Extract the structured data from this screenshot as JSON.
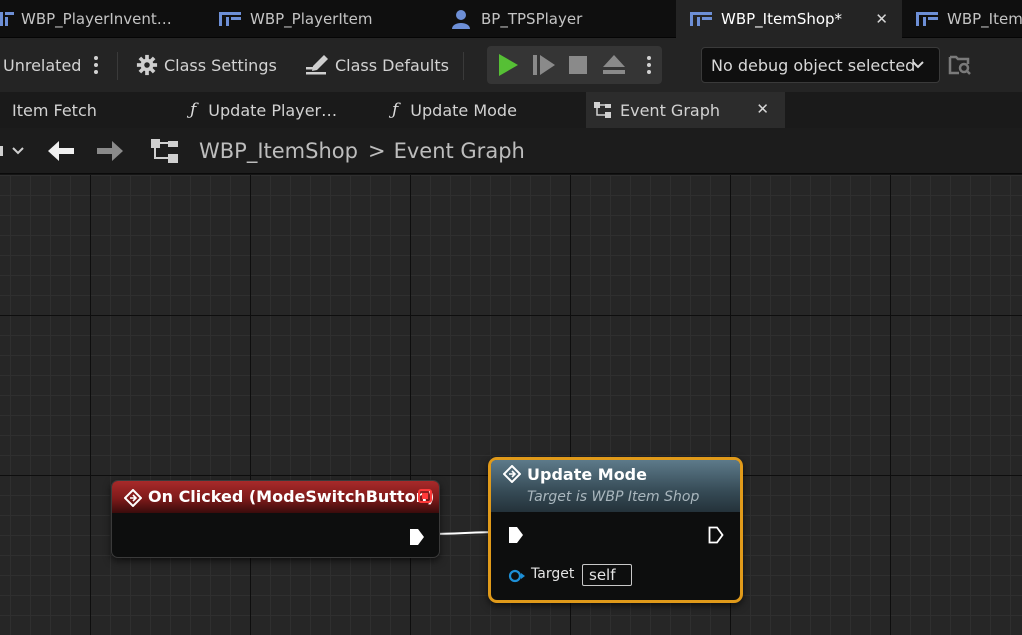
{
  "doc_tabs": [
    {
      "label": "WBP_PlayerInvent…",
      "active": false
    },
    {
      "label": "WBP_PlayerItem",
      "active": false
    },
    {
      "label": "BP_TPSPlayer",
      "active": false
    },
    {
      "label": "WBP_ItemShop*",
      "active": true
    },
    {
      "label": "WBP_Item",
      "active": false
    }
  ],
  "toolbar": {
    "unrelated_label": "Unrelated",
    "class_settings_label": "Class Settings",
    "class_defaults_label": "Class Defaults",
    "debug_selector_value": "No debug object selected"
  },
  "graph_tabs": [
    {
      "label": "Item Fetch",
      "kind": "graph"
    },
    {
      "label": "Update Player…",
      "kind": "function"
    },
    {
      "label": "Update Mode",
      "kind": "function"
    },
    {
      "label": "Event Graph",
      "kind": "graph",
      "active": true
    }
  ],
  "breadcrumb": {
    "blueprint": "WBP_ItemShop",
    "separator": ">",
    "graph": "Event Graph"
  },
  "nodes": {
    "event": {
      "title": "On Clicked (ModeSwitchButton)"
    },
    "function": {
      "title": "Update Mode",
      "subtitle": "Target is WBP Item Shop",
      "target_label": "Target",
      "target_value": "self"
    }
  },
  "colors": {
    "play_green": "#56c035",
    "event_red": "#a82a2a",
    "function_blue": "#5d7a8a",
    "selection_orange": "#e09a1a",
    "object_pin_blue": "#1d8fd6",
    "cursor_magenta": "#e0107a"
  }
}
